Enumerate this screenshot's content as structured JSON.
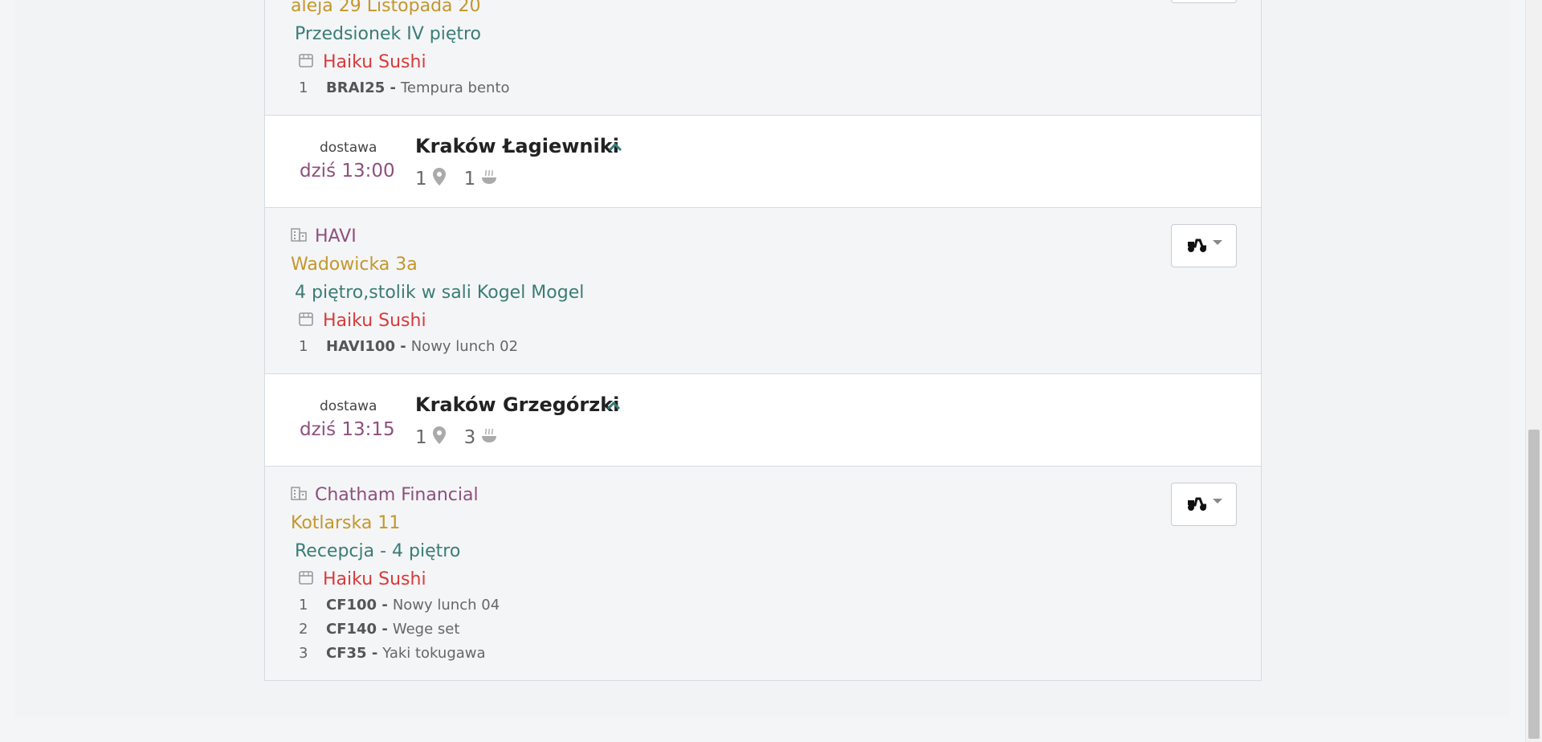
{
  "orders_top": {
    "street": "aleja 29 Listopada 20",
    "location": "Przedsionek IV piętro",
    "restaurant": "Haiku Sushi",
    "items": [
      {
        "num": "1",
        "code": "BRAI25 -",
        "name": "Tempura bento"
      }
    ]
  },
  "groups": [
    {
      "type": "dostawa",
      "time": "dziś 13:00",
      "city": "Kraków Łagiewniki",
      "locations_count": "1",
      "meals_count": "1",
      "order": {
        "company": "HAVI",
        "street": "Wadowicka 3a",
        "location": "4 piętro,stolik w sali Kogel Mogel",
        "restaurant": "Haiku Sushi",
        "items": [
          {
            "num": "1",
            "code": "HAVI100 -",
            "name": "Nowy lunch 02"
          }
        ]
      }
    },
    {
      "type": "dostawa",
      "time": "dziś 13:15",
      "city": "Kraków Grzegórzki",
      "locations_count": "1",
      "meals_count": "3",
      "order": {
        "company": "Chatham Financial",
        "street": "Kotlarska 11",
        "location": "Recepcja - 4 piętro",
        "restaurant": "Haiku Sushi",
        "items": [
          {
            "num": "1",
            "code": "CF100 -",
            "name": "Nowy lunch 04"
          },
          {
            "num": "2",
            "code": "CF140 -",
            "name": "Wege set"
          },
          {
            "num": "3",
            "code": "CF35 -",
            "name": "Yaki tokugawa"
          }
        ]
      }
    }
  ],
  "icons": {
    "building": "building-icon",
    "store": "store-icon",
    "pin": "location-pin-icon",
    "meal": "meal-bowl-icon",
    "scooter": "scooter-icon",
    "chevron": "chevron-up-icon"
  },
  "colors": {
    "time": "#8e4f7d",
    "company": "#8e4f7d",
    "street": "#c4972b",
    "location": "#3a7d76",
    "restaurant": "#d83a3a",
    "chevron": "#3a7d76"
  }
}
